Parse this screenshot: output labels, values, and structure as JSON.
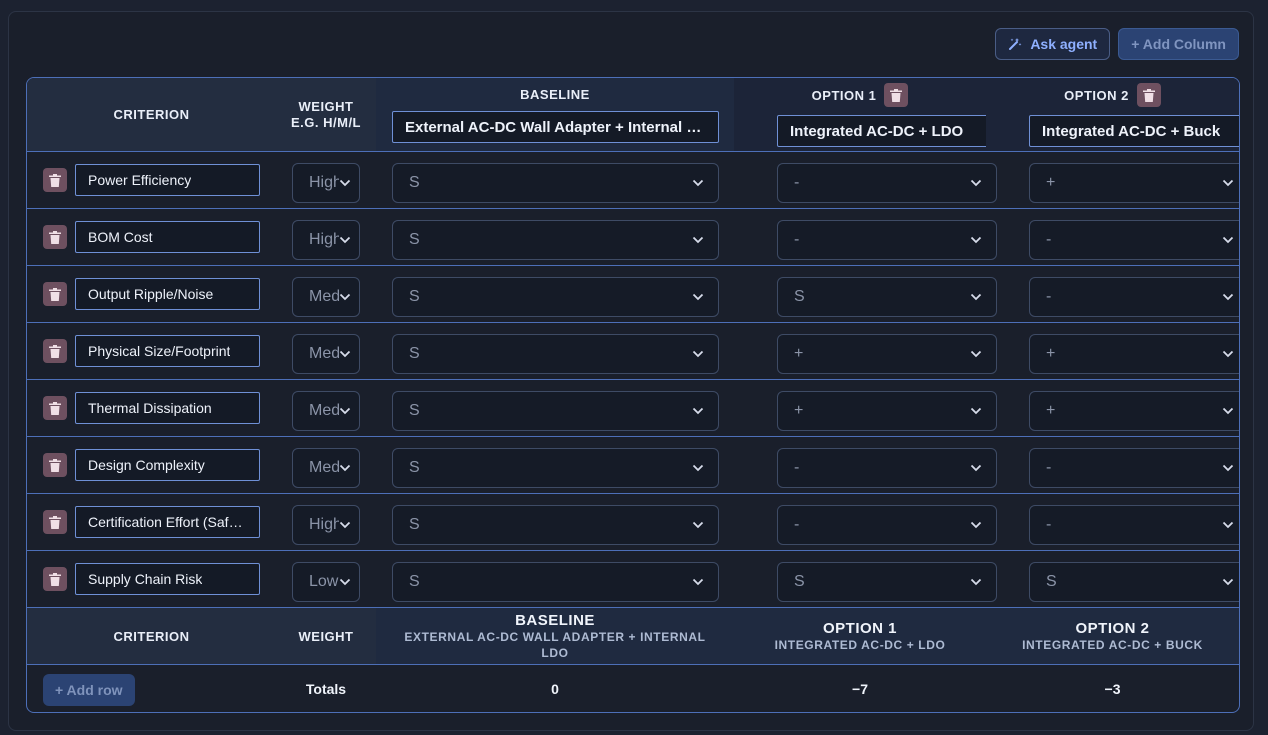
{
  "toolbar": {
    "ask_agent_label": "Ask agent",
    "add_column_label": "+ Add Column"
  },
  "header": {
    "criterion_label": "CRITERION",
    "weight_label_line1": "WEIGHT",
    "weight_label_line2": "E.G. H/M/L",
    "columns": [
      {
        "label": "BASELINE",
        "name": "External AC-DC Wall Adapter + Internal LDO"
      },
      {
        "label": "OPTION 1",
        "name": "Integrated AC-DC + LDO"
      },
      {
        "label": "OPTION 2",
        "name": "Integrated AC-DC + Buck"
      }
    ]
  },
  "rows": [
    {
      "criterion": "Power Efficiency",
      "weight": "High",
      "baseline": "S",
      "option1": "-",
      "option2": "+"
    },
    {
      "criterion": "BOM Cost",
      "weight": "High",
      "baseline": "S",
      "option1": "-",
      "option2": "-"
    },
    {
      "criterion": "Output Ripple/Noise",
      "weight": "Medium",
      "baseline": "S",
      "option1": "S",
      "option2": "-"
    },
    {
      "criterion": "Physical Size/Footprint",
      "weight": "Medium",
      "baseline": "S",
      "option1": "+",
      "option2": "+"
    },
    {
      "criterion": "Thermal Dissipation",
      "weight": "Medium",
      "baseline": "S",
      "option1": "+",
      "option2": "+"
    },
    {
      "criterion": "Design Complexity",
      "weight": "Medium",
      "baseline": "S",
      "option1": "-",
      "option2": "-"
    },
    {
      "criterion": "Certification Effort (Safety)",
      "weight": "High",
      "baseline": "S",
      "option1": "-",
      "option2": "-"
    },
    {
      "criterion": "Supply Chain Risk",
      "weight": "Low",
      "baseline": "S",
      "option1": "S",
      "option2": "S"
    }
  ],
  "footer": {
    "criterion_label": "CRITERION",
    "weight_label": "WEIGHT",
    "columns": [
      {
        "title": "BASELINE",
        "subtitle": "EXTERNAL AC-DC WALL ADAPTER + INTERNAL LDO"
      },
      {
        "title": "OPTION 1",
        "subtitle": "INTEGRATED AC-DC + LDO"
      },
      {
        "title": "OPTION 2",
        "subtitle": "INTEGRATED AC-DC + BUCK"
      }
    ]
  },
  "totals": {
    "add_row_label": "+ Add row",
    "label": "Totals",
    "baseline": "0",
    "option1": "−7",
    "option2": "−3"
  }
}
